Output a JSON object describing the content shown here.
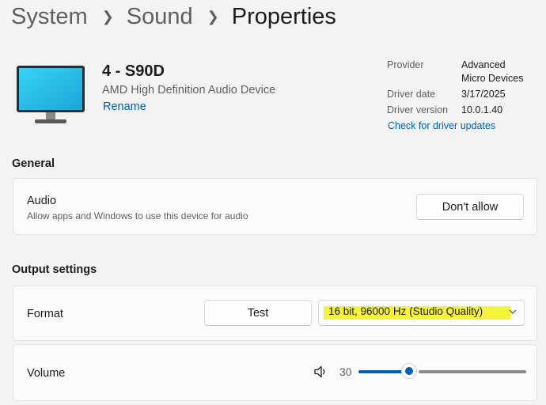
{
  "breadcrumb": {
    "items": [
      "System",
      "Sound"
    ],
    "current": "Properties"
  },
  "device": {
    "name": "4 - S90D",
    "description": "AMD High Definition Audio Device",
    "rename_label": "Rename",
    "icon": "monitor-icon"
  },
  "driver": {
    "provider_label": "Provider",
    "provider_value_line1": "Advanced",
    "provider_value_line2": "Micro Devices",
    "date_label": "Driver date",
    "date_value": "3/17/2025",
    "version_label": "Driver version",
    "version_value": "10.0.1.40",
    "update_link": "Check for driver updates"
  },
  "general": {
    "section_title": "General",
    "audio_title": "Audio",
    "audio_subtitle": "Allow apps and Windows to use this device for audio",
    "dont_allow_label": "Don't allow"
  },
  "output": {
    "section_title": "Output settings",
    "format_label": "Format",
    "test_label": "Test",
    "format_selected": "16 bit, 96000 Hz (Studio Quality)",
    "volume_label": "Volume",
    "volume_value": "30",
    "volume_level": 0.3
  },
  "colors": {
    "accent": "#005fb8",
    "highlight": "#f5f23a",
    "background": "#f3f3f3",
    "card": "#fbfbfb"
  }
}
